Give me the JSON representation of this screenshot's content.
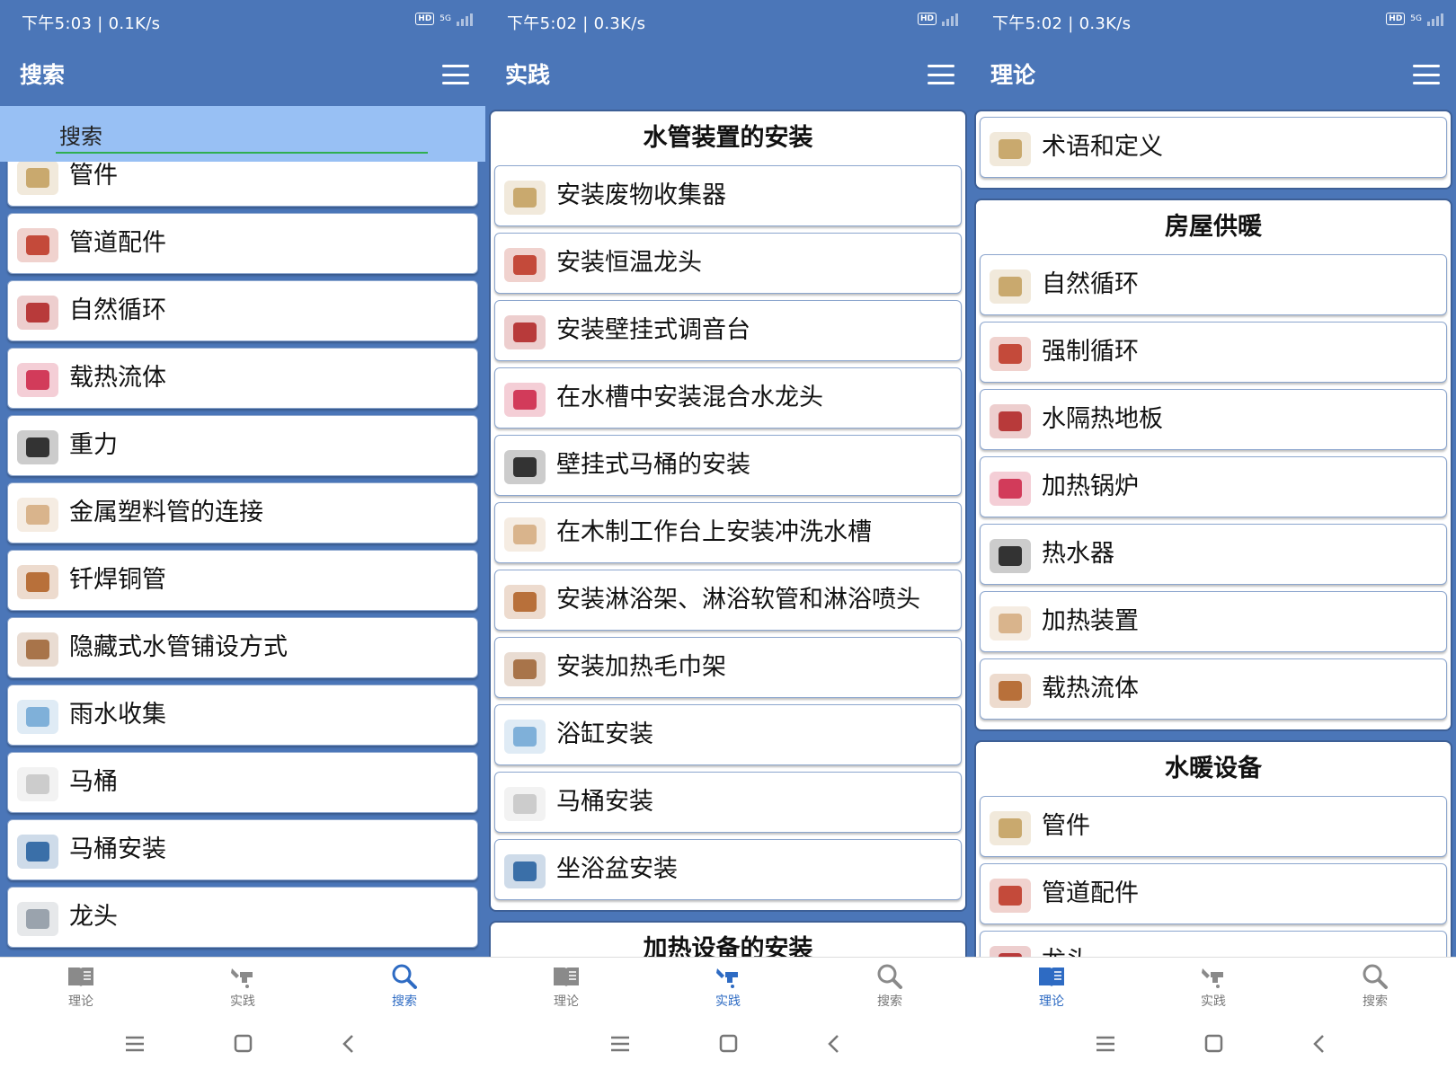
{
  "screens": {
    "search": {
      "status_text": "下午5:03 | 0.1K/s",
      "network": "5G",
      "title": "搜索",
      "search_placeholder": "搜索",
      "items": [
        "管件",
        "管道配件",
        "自然循环",
        "载热流体",
        "重力",
        "金属塑料管的连接",
        "钎焊铜管",
        "隐藏式水管铺设方式",
        "雨水收集",
        "马桶",
        "马桶安装",
        "龙头"
      ]
    },
    "practice": {
      "status_text": "下午5:02 | 0.3K/s",
      "title": "实践",
      "sections": [
        {
          "title": "水管装置的安装",
          "items": [
            "安装废物收集器",
            "安装恒温龙头",
            "安装壁挂式调音台",
            "在水槽中安装混合水龙头",
            "壁挂式马桶的安装",
            "在木制工作台上安装冲洗水槽",
            "安装淋浴架、淋浴软管和淋浴喷头",
            "安装加热毛巾架",
            "浴缸安装",
            "马桶安装",
            "坐浴盆安装"
          ]
        },
        {
          "title": "加热设备的安装",
          "items": []
        }
      ]
    },
    "theory": {
      "status_text": "下午5:02 | 0.3K/s",
      "network": "5G",
      "title": "理论",
      "sections": [
        {
          "title": "",
          "items": [
            "术语和定义"
          ]
        },
        {
          "title": "房屋供暖",
          "items": [
            "自然循环",
            "强制循环",
            "水隔热地板",
            "加热锅炉",
            "热水器",
            "加热装置",
            "载热流体"
          ]
        },
        {
          "title": "水暖设备",
          "items": [
            "管件",
            "管道配件",
            "龙头"
          ]
        }
      ]
    }
  },
  "bottom_nav": {
    "theory": "理论",
    "practice": "实践",
    "search": "搜索"
  },
  "colors": {
    "primary": "#4b76b8",
    "search_bg": "#98c0f4",
    "accent_line": "#2fae4f",
    "active_tab": "#2e6bc3"
  }
}
